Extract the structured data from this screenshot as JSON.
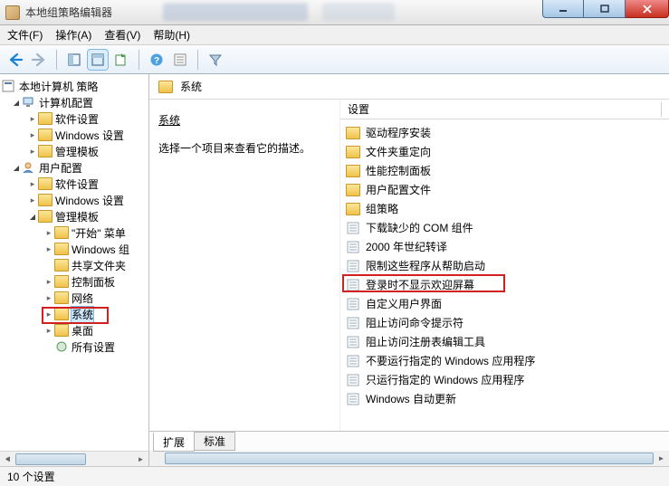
{
  "window": {
    "title": "本地组策略编辑器"
  },
  "menu": {
    "file": "文件(F)",
    "action": "操作(A)",
    "view": "查看(V)",
    "help": "帮助(H)"
  },
  "tree": {
    "root": "本地计算机 策略",
    "computer": "计算机配置",
    "c_soft": "软件设置",
    "c_win": "Windows 设置",
    "c_admin": "管理模板",
    "user": "用户配置",
    "u_soft": "软件设置",
    "u_win": "Windows 设置",
    "u_admin": "管理模板",
    "start_menu": "\"开始\" 菜单",
    "win_comp": "Windows 组",
    "shared": "共享文件夹",
    "ctrl_panel": "控制面板",
    "network": "网络",
    "system": "系统",
    "desktop": "桌面",
    "all_settings": "所有设置"
  },
  "right": {
    "heading": "系统",
    "desc_prompt": "选择一个项目来查看它的描述。",
    "col_header": "设置",
    "items": [
      {
        "type": "folder",
        "label": "驱动程序安装"
      },
      {
        "type": "folder",
        "label": "文件夹重定向"
      },
      {
        "type": "folder",
        "label": "性能控制面板"
      },
      {
        "type": "folder",
        "label": "用户配置文件"
      },
      {
        "type": "folder",
        "label": "组策略"
      },
      {
        "type": "setting",
        "label": "下载缺少的 COM 组件"
      },
      {
        "type": "setting",
        "label": "2000 年世纪转译"
      },
      {
        "type": "setting",
        "label": "限制这些程序从帮助启动"
      },
      {
        "type": "setting",
        "label": "登录时不显示欢迎屏幕",
        "highlight": true
      },
      {
        "type": "setting",
        "label": "自定义用户界面"
      },
      {
        "type": "setting",
        "label": "阻止访问命令提示符"
      },
      {
        "type": "setting",
        "label": "阻止访问注册表编辑工具"
      },
      {
        "type": "setting",
        "label": "不要运行指定的 Windows 应用程序"
      },
      {
        "type": "setting",
        "label": "只运行指定的 Windows 应用程序"
      },
      {
        "type": "setting",
        "label": "Windows 自动更新"
      }
    ],
    "tabs": {
      "extended": "扩展",
      "standard": "标准"
    }
  },
  "status": {
    "text": "10 个设置"
  }
}
